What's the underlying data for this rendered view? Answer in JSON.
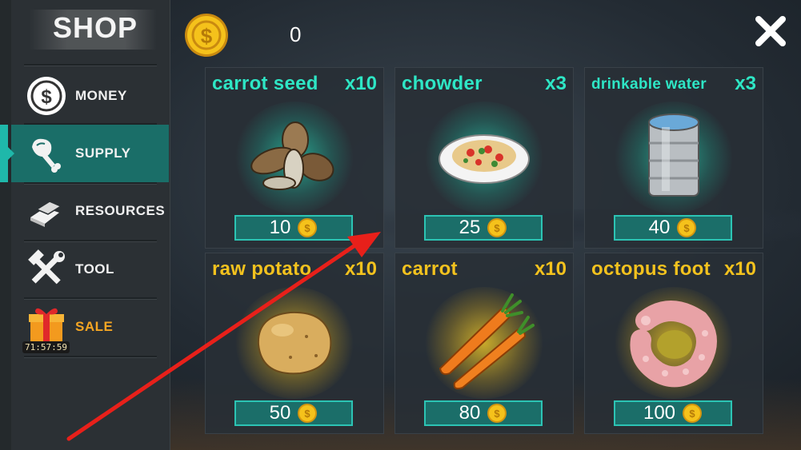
{
  "shop": {
    "title": "SHOP",
    "balance": "0"
  },
  "sidebar": {
    "items": [
      {
        "label": "MONEY",
        "icon": "dollar-coin-icon",
        "active": false
      },
      {
        "label": "SUPPLY",
        "icon": "meat-leg-icon",
        "active": true
      },
      {
        "label": "RESOURCES",
        "icon": "materials-icon",
        "active": false
      },
      {
        "label": "TOOL",
        "icon": "hammer-wrench-icon",
        "active": false
      },
      {
        "label": "SALE",
        "icon": "gift-box-icon",
        "active": false,
        "timer": "71:57:59"
      }
    ]
  },
  "items": [
    {
      "name": "carrot seed",
      "qty": "x10",
      "price": "10",
      "rarity_color": "#2ee6c5",
      "icon": "seeds-icon"
    },
    {
      "name": "chowder",
      "qty": "x3",
      "price": "25",
      "rarity_color": "#2ee6c5",
      "icon": "pasta-plate-icon"
    },
    {
      "name": "drinkable water",
      "qty": "x3",
      "price": "40",
      "rarity_color": "#2ee6c5",
      "icon": "water-can-icon"
    },
    {
      "name": "raw potato",
      "qty": "x10",
      "price": "50",
      "rarity_color": "#f3c21e",
      "icon": "potato-icon"
    },
    {
      "name": "carrot",
      "qty": "x10",
      "price": "80",
      "rarity_color": "#f3c21e",
      "icon": "carrot-icon"
    },
    {
      "name": "octopus foot",
      "qty": "x10",
      "price": "100",
      "rarity_color": "#f3c21e",
      "icon": "octopus-tentacle-icon"
    }
  ],
  "colors": {
    "accent_teal": "#2ee6c5",
    "accent_gold": "#f3c21e",
    "active_tab": "#1a6e68",
    "annotation_arrow": "#e8201a"
  }
}
